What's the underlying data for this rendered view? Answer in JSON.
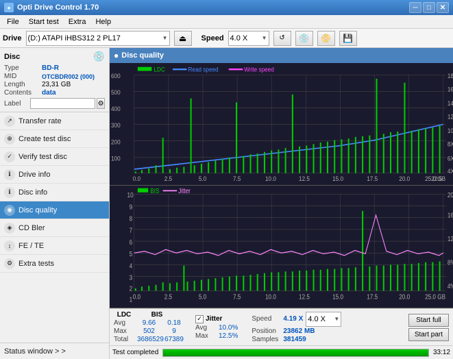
{
  "app": {
    "title": "Opti Drive Control 1.70",
    "icon": "●"
  },
  "titlebar": {
    "minimize": "─",
    "maximize": "□",
    "close": "✕"
  },
  "menu": {
    "items": [
      "File",
      "Start test",
      "Extra",
      "Help"
    ]
  },
  "drive_bar": {
    "drive_label": "Drive",
    "drive_value": "(D:) ATAPI iHBS312  2 PL17",
    "speed_label": "Speed",
    "speed_value": "4.0 X",
    "eject_icon": "⏏"
  },
  "disc": {
    "title": "Disc",
    "type_label": "Type",
    "type_value": "BD-R",
    "mid_label": "MID",
    "mid_value": "OTCBDR002 (000)",
    "length_label": "Length",
    "length_value": "23,31 GB",
    "contents_label": "Contents",
    "contents_value": "data",
    "label_label": "Label",
    "label_value": ""
  },
  "nav": {
    "items": [
      {
        "id": "transfer-rate",
        "label": "Transfer rate",
        "icon": "↗"
      },
      {
        "id": "create-test-disc",
        "label": "Create test disc",
        "icon": "⊕"
      },
      {
        "id": "verify-test-disc",
        "label": "Verify test disc",
        "icon": "✓"
      },
      {
        "id": "drive-info",
        "label": "Drive info",
        "icon": "ℹ"
      },
      {
        "id": "disc-info",
        "label": "Disc info",
        "icon": "ℹ"
      },
      {
        "id": "disc-quality",
        "label": "Disc quality",
        "icon": "◉",
        "active": true
      },
      {
        "id": "cd-bler",
        "label": "CD Bler",
        "icon": "◈"
      },
      {
        "id": "fe-te",
        "label": "FE / TE",
        "icon": "↕"
      },
      {
        "id": "extra-tests",
        "label": "Extra tests",
        "icon": "⚙"
      }
    ],
    "status_window": "Status window > >"
  },
  "disc_quality": {
    "title": "Disc quality",
    "legend": {
      "ldc": "LDC",
      "read": "Read speed",
      "write": "Write speed",
      "bis": "BIS",
      "jitter": "Jitter"
    }
  },
  "stats": {
    "ldc_header": "LDC",
    "bis_header": "BIS",
    "jitter_label": "Jitter",
    "jitter_checked": true,
    "rows": [
      {
        "label": "Avg",
        "ldc": "9.66",
        "bis": "0.18",
        "jitter": "10.0%"
      },
      {
        "label": "Max",
        "ldc": "502",
        "bis": "9",
        "jitter": "12.5%"
      },
      {
        "label": "Total",
        "ldc": "3686529",
        "bis": "67389",
        "jitter": ""
      }
    ],
    "speed_label": "Speed",
    "speed_value": "4.19 X",
    "speed_select": "4.0 X",
    "position_label": "Position",
    "position_value": "23862 MB",
    "samples_label": "Samples",
    "samples_value": "381459",
    "start_full": "Start full",
    "start_part": "Start part"
  },
  "status_bar": {
    "text": "Test completed",
    "progress": 100,
    "time": "33:12"
  }
}
